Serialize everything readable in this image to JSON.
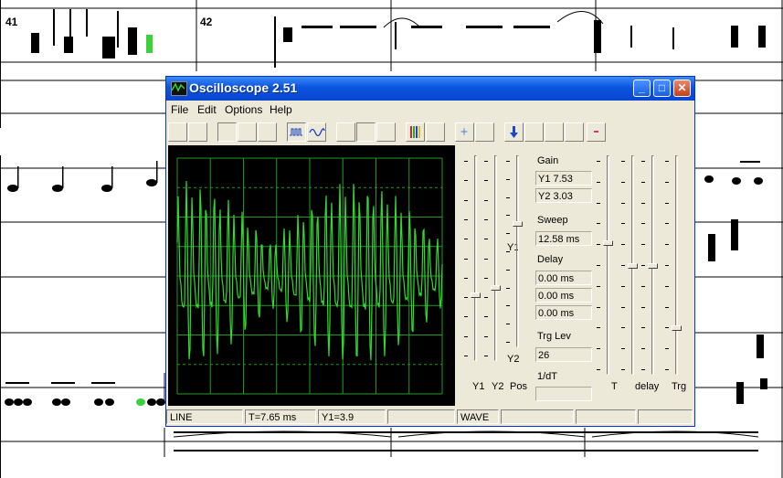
{
  "score": {
    "measure_numbers": [
      "41",
      "42"
    ]
  },
  "window": {
    "title": "Oscilloscope 2.51",
    "menus": [
      "File",
      "Edit",
      "Options",
      "Help"
    ]
  },
  "controls": {
    "gain_label": "Gain",
    "y1_gain": "Y1  7.53",
    "y2_gain": "Y2  3.03",
    "sweep_label": "Sweep",
    "sweep_value": "12.58 ms",
    "delay_label": "Delay",
    "delay_values": [
      "0.00 ms",
      "0.00 ms",
      "0.00 ms"
    ],
    "trg_lev_label": "Trg Lev",
    "trg_lev_value": "26",
    "inv_dt_label": "1/dT",
    "inv_dt_value": "",
    "y1_slider_label": "Y1",
    "y2_slider_label": "Y2",
    "pos_y1_label": "Y1",
    "pos_y2_label": "Y2",
    "pos_label": "Pos",
    "t_label": "T",
    "delay_slider_label": "delay",
    "trg_slider_label": "Trg"
  },
  "status": {
    "mode": "LINE",
    "time": "T=7.65 ms",
    "y1": "Y1=3.9",
    "cell4": "",
    "wave": "WAVE",
    "cell6": "",
    "cell7": "",
    "cell8": ""
  },
  "colors": {
    "trace": "#2edc2e",
    "grid": "#1f9a1f",
    "titlebar": "#0a54e0",
    "window": "#ece9d8"
  }
}
